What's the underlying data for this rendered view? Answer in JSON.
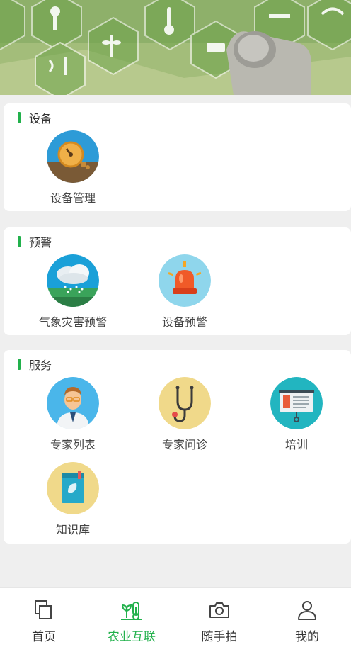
{
  "sections": [
    {
      "title": "设备",
      "items": [
        {
          "label": "设备管理",
          "icon": "device-management-icon"
        }
      ]
    },
    {
      "title": "预警",
      "items": [
        {
          "label": "气象灾害预警",
          "icon": "weather-warning-icon"
        },
        {
          "label": "设备预警",
          "icon": "alarm-light-icon"
        }
      ]
    },
    {
      "title": "服务",
      "items": [
        {
          "label": "专家列表",
          "icon": "doctor-icon"
        },
        {
          "label": "专家问诊",
          "icon": "stethoscope-icon"
        },
        {
          "label": "培训",
          "icon": "training-board-icon"
        },
        {
          "label": "知识库",
          "icon": "book-icon"
        }
      ]
    }
  ],
  "tabbar": {
    "items": [
      {
        "label": "首页",
        "icon": "home-icon"
      },
      {
        "label": "农业互联",
        "icon": "plant-sensor-icon"
      },
      {
        "label": "随手拍",
        "icon": "camera-icon"
      },
      {
        "label": "我的",
        "icon": "user-icon"
      }
    ],
    "active_color": "#22b14c"
  },
  "colors": {
    "accent": "#22b14c",
    "background": "#efefef"
  }
}
